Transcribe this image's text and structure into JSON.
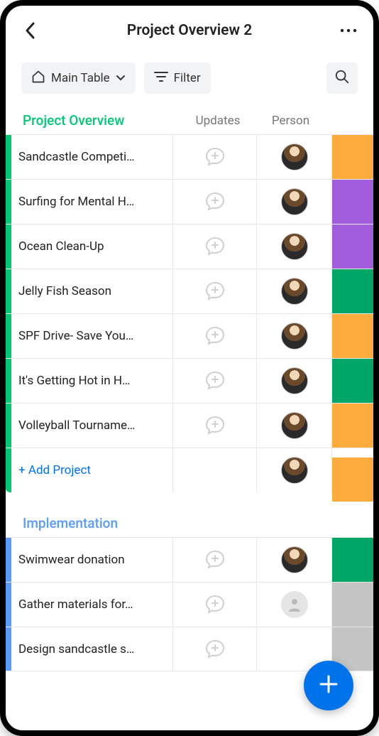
{
  "header": {
    "title": "Project Overview 2"
  },
  "toolbar": {
    "view_label": "Main Table",
    "filter_label": "Filter"
  },
  "columns": {
    "updates": "Updates",
    "person": "Person"
  },
  "groups": [
    {
      "name": "Project Overview",
      "color": "#00c875",
      "add_label": "+ Add Project",
      "rows": [
        {
          "name": "Sandcastle Competi…",
          "person": "avatar",
          "status_color": "#fdab3d"
        },
        {
          "name": "Surfing for Mental H…",
          "person": "avatar",
          "status_color": "#a25ddc"
        },
        {
          "name": "Ocean Clean-Up",
          "person": "avatar",
          "status_color": "#a25ddc"
        },
        {
          "name": "Jelly Fish Season",
          "person": "avatar",
          "status_color": "#00a667"
        },
        {
          "name": "SPF Drive- Save You…",
          "person": "avatar",
          "status_color": "#fdab3d"
        },
        {
          "name": "It's Getting Hot in H…",
          "person": "avatar",
          "status_color": "#00a667"
        },
        {
          "name": "Volleyball Tourname…",
          "person": "avatar",
          "status_color": "#fdab3d"
        }
      ],
      "add_row": {
        "person": "avatar",
        "status_color": "#fdab3d",
        "partial": true
      }
    },
    {
      "name": "Implementation",
      "color": "#579bfc",
      "rows": [
        {
          "name": "Swimwear donation",
          "person": "avatar",
          "status_color": "#00a667"
        },
        {
          "name": "Gather materials for…",
          "person": "empty",
          "status_color": "#c4c4c4"
        },
        {
          "name": "Design sandcastle s…",
          "person": "hidden",
          "status_color": "#c4c4c4"
        }
      ]
    }
  ]
}
